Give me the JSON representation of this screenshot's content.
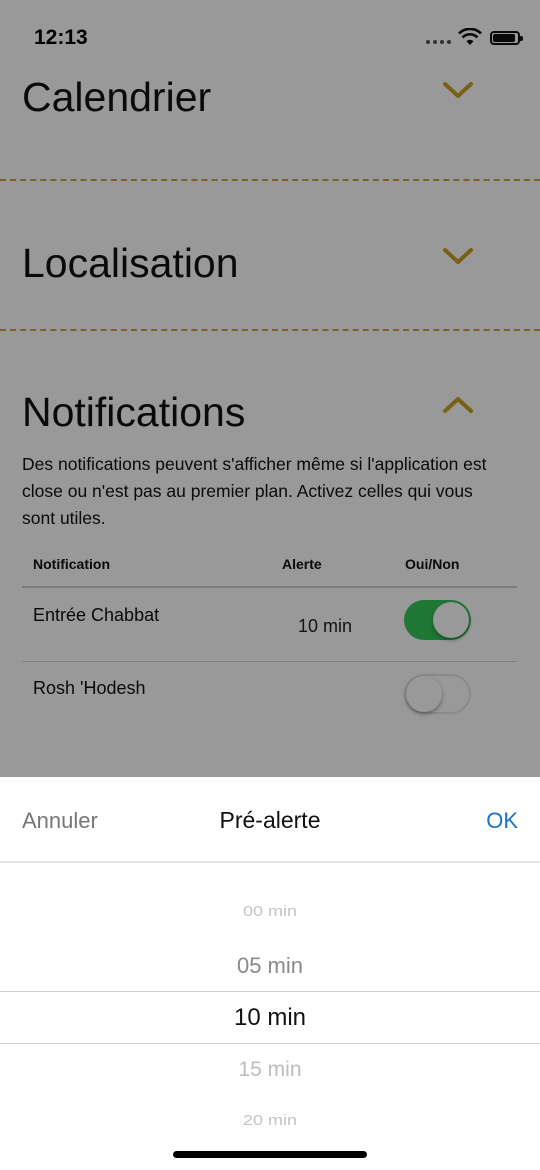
{
  "status_bar": {
    "time": "12:13"
  },
  "sections": {
    "calendar": "Calendrier",
    "location": "Localisation",
    "notifications": "Notifications"
  },
  "notifications": {
    "description": "Des notifications peuvent s'afficher même si l'application est close ou n'est pas au premier plan. Activez celles qui vous sont utiles.",
    "headers": {
      "name": "Notification",
      "alert": "Alerte",
      "toggle": "Oui/Non"
    },
    "rows": [
      {
        "name": "Entrée Chabbat",
        "alert": "10 min",
        "enabled": true
      },
      {
        "name": "Rosh 'Hodesh",
        "alert": "",
        "enabled": false
      }
    ]
  },
  "picker": {
    "cancel": "Annuler",
    "title": "Pré-alerte",
    "ok": "OK",
    "options": [
      "00 min",
      "05 min",
      "10 min",
      "15 min",
      "20 min"
    ],
    "selected": "10 min"
  },
  "colors": {
    "accent": "#c9a227",
    "toggle_on": "#34c759",
    "ok_link": "#1a73c9"
  }
}
